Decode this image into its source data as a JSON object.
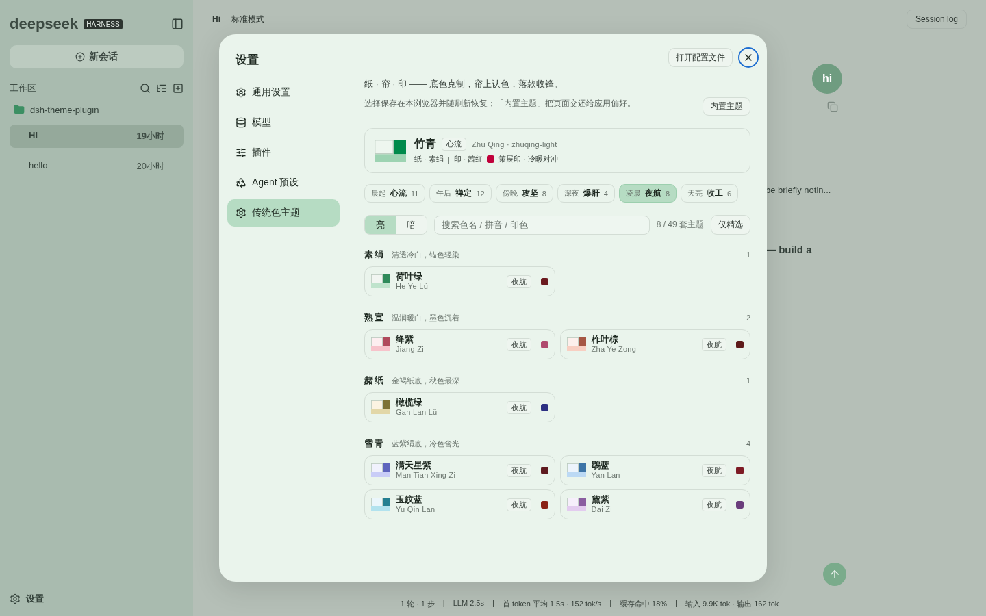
{
  "background": {
    "sidebar": {
      "logo": "deepseek",
      "badge": "HARNESS",
      "new_chat": "新会话",
      "workspace_label": "工作区",
      "folder": "dsh-theme-plugin",
      "sessions": [
        {
          "title": "Hi",
          "time": "19小时",
          "selected": true
        },
        {
          "title": "hello",
          "time": "20小时",
          "selected": false
        }
      ],
      "settings": "设置"
    },
    "header": {
      "title": "Hi",
      "mode": "标准模式",
      "session_log": "Session log"
    },
    "chat": {
      "avatar": "hi",
      "snippets": [
        "be briefly notin...",
        "— build a"
      ]
    },
    "status_bar": {
      "items": [
        "1 轮 · 1 步",
        "LLM 2.5s",
        "首 token 平均 1.5s · 152 tok/s",
        "缓存命中 18%",
        "输入 9.9K tok · 输出 162 tok"
      ],
      "separator": "|"
    }
  },
  "dialog": {
    "title": "设置",
    "nav": [
      {
        "label": "通用设置",
        "kind": "general",
        "selected": false
      },
      {
        "label": "模型",
        "kind": "model",
        "selected": false
      },
      {
        "label": "插件",
        "kind": "plugins",
        "selected": false
      },
      {
        "label": "Agent 预设",
        "kind": "agent",
        "selected": false
      },
      {
        "label": "传统色主题",
        "kind": "theme",
        "selected": true
      }
    ],
    "open_config": "打开配置文件",
    "tagline": "纸 · 帘 · 印 —— 底色克制，帘上认色，落款收锋。",
    "note": "选择保存在本浏览器并随刷新恢复；「内置主题」把页面交还给应用偏好。",
    "builtin_button": "内置主题",
    "current": {
      "name": "竹青",
      "tag": "心流",
      "pinyin": "Zhu Qing · zhuqing-light",
      "paper": "纸 · 素绢",
      "separator": "|",
      "seal": "印 · 茜红",
      "color": "#c0003a",
      "note": "策展印 · 冷暖对冲",
      "swatch": [
        {
          "color": "#eef6ef"
        },
        {
          "color": "#008a4b"
        },
        {
          "color": "#9dd3b2"
        }
      ]
    },
    "moods": [
      {
        "time": "晨起",
        "name": "心流",
        "count": "11",
        "selected": false
      },
      {
        "time": "午后",
        "name": "禅定",
        "count": "12",
        "selected": false
      },
      {
        "time": "傍晚",
        "name": "攻坚",
        "count": "8",
        "selected": false
      },
      {
        "time": "深夜",
        "name": "爆肝",
        "count": "4",
        "selected": false
      },
      {
        "time": "凌晨",
        "name": "夜航",
        "count": "8",
        "selected": true
      },
      {
        "time": "天亮",
        "name": "收工",
        "count": "6",
        "selected": false
      }
    ],
    "modes": [
      {
        "label": "亮",
        "selected": true
      },
      {
        "label": "暗",
        "selected": false
      }
    ],
    "search": {
      "placeholder": "搜索色名 / 拼音 / 印色"
    },
    "count": "8 / 49 套主题",
    "filter_button": "仅精选",
    "groups": [
      {
        "name": "素绢",
        "desc": "清透冷白，锚色轻染",
        "count": "1",
        "themes": [
          {
            "name": "荷叶绿",
            "pinyin": "He Ye Lü",
            "tag": "夜航",
            "color": "#6b1a1f",
            "swatch": [
              {
                "color": "#f1f5f1"
              },
              {
                "color": "#2f8a5a"
              },
              {
                "color": "#bfe3cc"
              }
            ]
          }
        ]
      },
      {
        "name": "熟宣",
        "desc": "温润暖白，墨色沉着",
        "count": "2",
        "themes": [
          {
            "name": "绛紫",
            "pinyin": "Jiang Zi",
            "tag": "夜航",
            "color": "#b04a6e",
            "swatch": [
              {
                "color": "#fdeef0"
              },
              {
                "color": "#b04a5c"
              },
              {
                "color": "#f7c3cb"
              }
            ]
          },
          {
            "name": "柞叶棕",
            "pinyin": "Zha Ye Zong",
            "tag": "夜航",
            "color": "#5e1a1a",
            "swatch": [
              {
                "color": "#fdf0ec"
              },
              {
                "color": "#a55744"
              },
              {
                "color": "#f8cfc2"
              }
            ]
          }
        ]
      },
      {
        "name": "赭纸",
        "desc": "金褐纸底，秋色最深",
        "count": "1",
        "themes": [
          {
            "name": "橄榄绿",
            "pinyin": "Gan Lan Lü",
            "tag": "夜航",
            "color": "#2c2f82",
            "swatch": [
              {
                "color": "#fbf3e2"
              },
              {
                "color": "#7c7236"
              },
              {
                "color": "#e2d7a8"
              }
            ]
          }
        ]
      },
      {
        "name": "雪青",
        "desc": "蓝紫绢底，冷色含光",
        "count": "4",
        "themes": [
          {
            "name": "满天星紫",
            "pinyin": "Man Tian Xing Zi",
            "tag": "夜航",
            "color": "#5e1a1f",
            "swatch": [
              {
                "color": "#f1f2fd"
              },
              {
                "color": "#5e64bd"
              },
              {
                "color": "#c9cdf7"
              }
            ]
          },
          {
            "name": "鶡蓝",
            "pinyin": "Yan Lan",
            "tag": "夜航",
            "color": "#7d1a24",
            "swatch": [
              {
                "color": "#edf4fc"
              },
              {
                "color": "#3d74a6"
              },
              {
                "color": "#bcd9f4"
              }
            ]
          },
          {
            "name": "玉鈫蓝",
            "pinyin": "Yu Qin Lan",
            "tag": "夜航",
            "color": "#8a2215",
            "swatch": [
              {
                "color": "#eaf6fb"
              },
              {
                "color": "#237f91"
              },
              {
                "color": "#b2e2ee"
              }
            ]
          },
          {
            "name": "黛紫",
            "pinyin": "Dai Zi",
            "tag": "夜航",
            "color": "#6a3d7c",
            "swatch": [
              {
                "color": "#f6effb"
              },
              {
                "color": "#8a5ea0"
              },
              {
                "color": "#e3ccef"
              }
            ]
          }
        ]
      }
    ]
  }
}
